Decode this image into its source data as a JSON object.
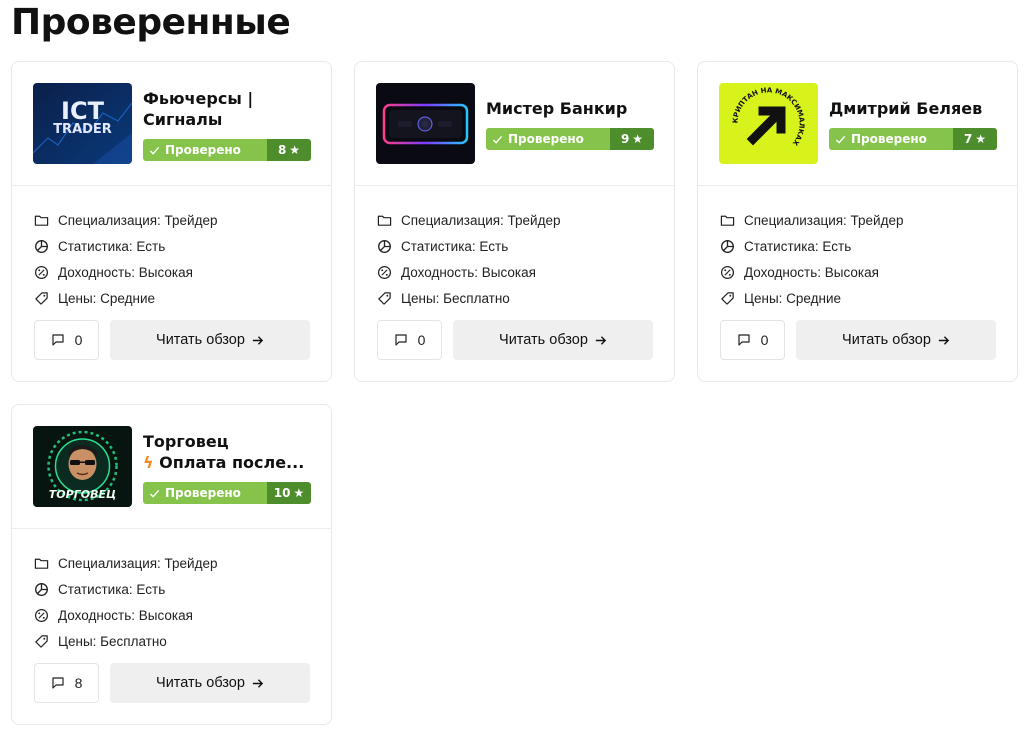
{
  "page": {
    "title": "Проверенные"
  },
  "cards": [
    {
      "name_line1": "Фьючерсы |",
      "name_line2": "Сигналы",
      "badge": {
        "verified": "Проверено",
        "score": "8"
      },
      "props": [
        {
          "icon": "folder-icon",
          "text": "Специализация: Трейдер"
        },
        {
          "icon": "pie-chart-icon",
          "text": "Статистика: Есть"
        },
        {
          "icon": "percent-icon",
          "text": "Доходность: Высокая"
        },
        {
          "icon": "tag-icon",
          "text": "Цены: Средние"
        }
      ],
      "comments": "0",
      "read_label": "Читать обзор",
      "thumb": {
        "logo_line1": "ICT",
        "logo_line2": "TRADER"
      }
    },
    {
      "name_line1": "Мистер Банкир",
      "name_line2": "",
      "badge": {
        "verified": "Проверено",
        "score": "9"
      },
      "props": [
        {
          "icon": "folder-icon",
          "text": "Специализация: Трейдер"
        },
        {
          "icon": "pie-chart-icon",
          "text": "Статистика: Есть"
        },
        {
          "icon": "percent-icon",
          "text": "Доходность: Высокая"
        },
        {
          "icon": "tag-icon",
          "text": "Цены: Бесплатно"
        }
      ],
      "comments": "0",
      "read_label": "Читать обзор"
    },
    {
      "name_line1": "Дмитрий Беляев",
      "name_line2": "",
      "badge": {
        "verified": "Проверено",
        "score": "7"
      },
      "props": [
        {
          "icon": "folder-icon",
          "text": "Специализация: Трейдер"
        },
        {
          "icon": "pie-chart-icon",
          "text": "Статистика: Есть"
        },
        {
          "icon": "percent-icon",
          "text": "Доходность: Высокая"
        },
        {
          "icon": "tag-icon",
          "text": "Цены: Средние"
        }
      ],
      "comments": "0",
      "read_label": "Читать обзор",
      "thumb": {
        "ring_text": "КРИПТАН НА МАКСИМАЛКАХ"
      }
    },
    {
      "name_line1": "Торговец",
      "name_line2": "Оплата после...",
      "badge": {
        "verified": "Проверено",
        "score": "10"
      },
      "props": [
        {
          "icon": "folder-icon",
          "text": "Специализация: Трейдер"
        },
        {
          "icon": "pie-chart-icon",
          "text": "Статистика: Есть"
        },
        {
          "icon": "percent-icon",
          "text": "Доходность: Высокая"
        },
        {
          "icon": "tag-icon",
          "text": "Цены: Бесплатно"
        }
      ],
      "comments": "8",
      "read_label": "Читать обзор",
      "thumb": {
        "logo_text": "ТОРГОВЕЦ"
      }
    }
  ],
  "colors": {
    "verified_bg": "#85c34a",
    "score_bg": "#4e8d2c",
    "button_bg": "#efefef",
    "border": "#e9e9e9",
    "lightning": "#f08a24",
    "crypto_yellow": "#d8f31c"
  }
}
